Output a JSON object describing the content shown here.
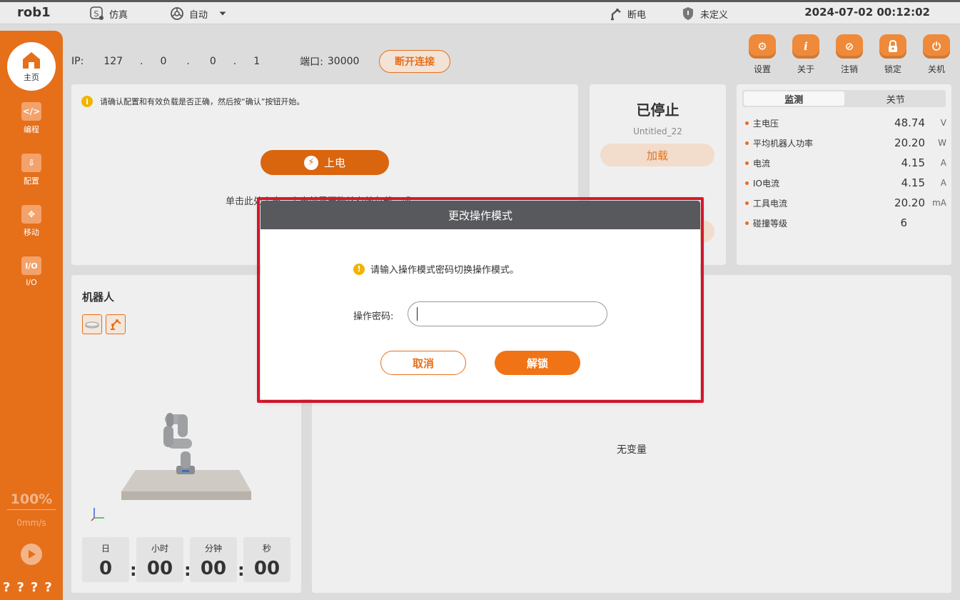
{
  "topbar": {
    "robot_name": "rob1",
    "sim_label": "仿真",
    "mode_label": "自动",
    "power_state": "断电",
    "safety_state": "未定义",
    "datetime": "2024-07-02 00:12:02"
  },
  "sidebar": {
    "items": [
      {
        "label": "主页",
        "icon": "home-icon"
      },
      {
        "label": "编程",
        "icon": "code-icon"
      },
      {
        "label": "配置",
        "icon": "config-icon"
      },
      {
        "label": "移动",
        "icon": "move-icon"
      },
      {
        "label": "I/O",
        "icon": "io-icon"
      }
    ],
    "speed_percent": "100%",
    "speed_value": "0mm/s",
    "help_marks": "????"
  },
  "connection": {
    "ip_label": "IP:",
    "ip_parts": [
      "127",
      ".",
      "0",
      ".",
      "0",
      ".",
      "1"
    ],
    "port_label": "端口:",
    "port_value": "30000",
    "disconnect_label": "断开连接"
  },
  "actions": [
    {
      "label": "设置",
      "icon": "settings-icon"
    },
    {
      "label": "关于",
      "icon": "info-icon"
    },
    {
      "label": "注销",
      "icon": "logout-icon"
    },
    {
      "label": "锁定",
      "icon": "lock-icon"
    },
    {
      "label": "关机",
      "icon": "power-icon"
    }
  ],
  "startup": {
    "notice": "请确认配置和有效负载是否正确，然后按“确认”按钮开始。",
    "power_on_label": "上电",
    "hint": "单击此处上电，上电前需要确认有效负载。或"
  },
  "program": {
    "status": "已停止",
    "name": "Untitled_22",
    "load_label": "加载"
  },
  "monitor": {
    "tabs": [
      "监测",
      "关节"
    ],
    "rows": [
      {
        "name": "主电压",
        "value": "48.74",
        "unit": "V"
      },
      {
        "name": "平均机器人功率",
        "value": "20.20",
        "unit": "W"
      },
      {
        "name": "电流",
        "value": "4.15",
        "unit": "A"
      },
      {
        "name": "IO电流",
        "value": "4.15",
        "unit": "A"
      },
      {
        "name": "工具电流",
        "value": "20.20",
        "unit": "mA"
      },
      {
        "name": "碰撞等级",
        "value": "6",
        "unit": ""
      }
    ]
  },
  "robot_panel": {
    "title": "机器人",
    "timer": [
      {
        "label": "日",
        "value": "0"
      },
      {
        "label": "小时",
        "value": "00"
      },
      {
        "label": "分钟",
        "value": "00"
      },
      {
        "label": "秒",
        "value": "00"
      }
    ]
  },
  "variables": {
    "empty_text": "无变量"
  },
  "modal": {
    "title": "更改操作模式",
    "message": "请输入操作模式密码切换操作模式。",
    "password_label": "操作密码:",
    "password_value": "",
    "cancel_label": "取消",
    "unlock_label": "解锁"
  },
  "colors": {
    "accent": "#e66f1a",
    "highlight_border": "#e0182d",
    "modal_header": "#57595c"
  }
}
